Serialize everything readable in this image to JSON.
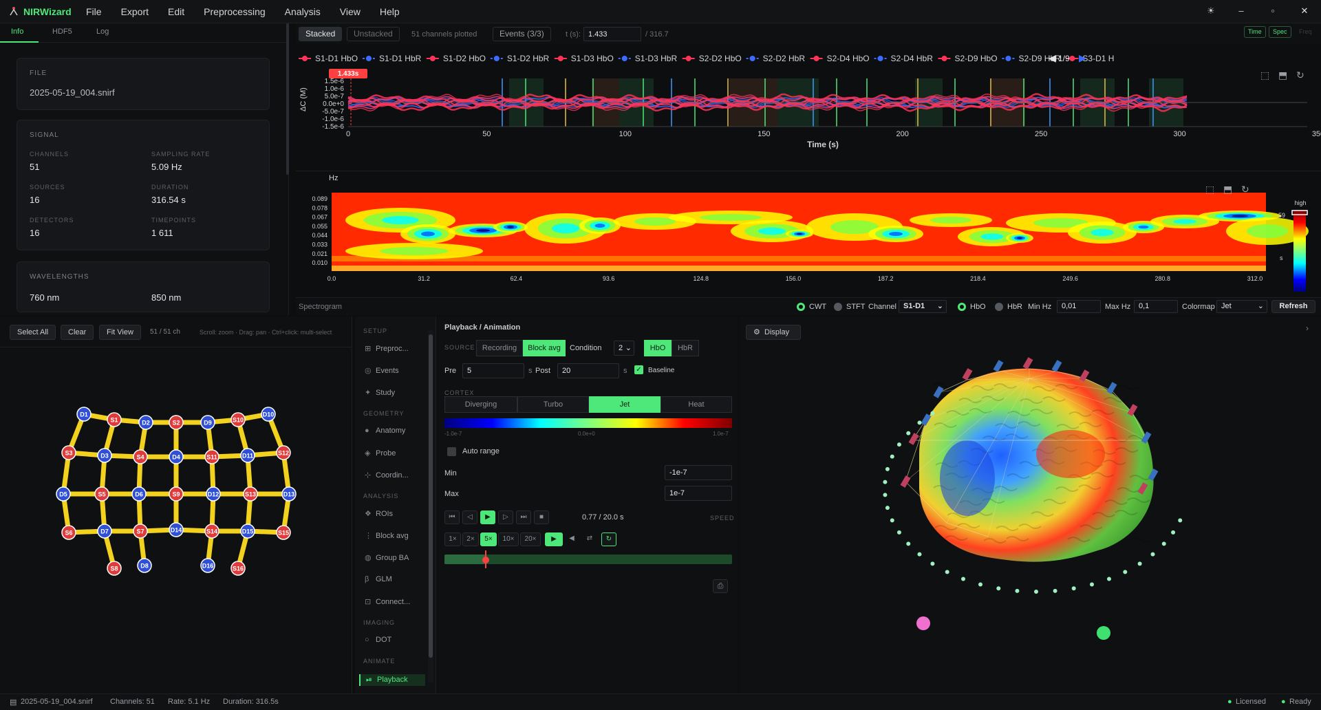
{
  "app": {
    "title": "NIRWizard",
    "menu": [
      "File",
      "Export",
      "Edit",
      "Preprocessing",
      "Analysis",
      "View",
      "Help"
    ]
  },
  "window": {
    "theme_icon": "☀",
    "min": "–",
    "max": "▫",
    "close": "✕"
  },
  "left_tabs": [
    "Info",
    "HDF5",
    "Log"
  ],
  "file": {
    "section": "FILE",
    "name": "2025-05-19_004.snirf"
  },
  "signal": {
    "section": "SIGNAL",
    "channels_label": "CHANNELS",
    "channels": "51",
    "sampling_label": "SAMPLING RATE",
    "sampling": "5.09 Hz",
    "sources_label": "SOURCES",
    "sources": "16",
    "duration_label": "DURATION",
    "duration": "316.54 s",
    "detectors_label": "DETECTORS",
    "detectors": "16",
    "timepoints_label": "TIMEPOINTS",
    "timepoints": "1 611"
  },
  "wavelengths": {
    "section": "WAVELENGTHS",
    "w1": "760 nm",
    "w2": "850 nm"
  },
  "toolbar": {
    "stacked": "Stacked",
    "unstacked": "Unstacked",
    "plotted": "51 channels plotted",
    "events": "Events (3/3)",
    "t_label": "t (s):",
    "t_value": "1.433",
    "t_total": "/ 316.7",
    "view_time": "Time",
    "view_spec": "Spec",
    "view_freq": "Freq"
  },
  "legend": {
    "items": [
      "S1-D1 HbO",
      "S1-D1 HbR",
      "S1-D2 HbO",
      "S1-D2 HbR",
      "S1-D3 HbO",
      "S1-D3 HbR",
      "S2-D2 HbO",
      "S2-D2 HbR",
      "S2-D4 HbO",
      "S2-D4 HbR",
      "S2-D9 HbO",
      "S2-D9 HbR",
      "S3-D1 H"
    ],
    "page": "1/9"
  },
  "timeseries": {
    "cursor_label": "1.433s",
    "ylabel": "ΔC (M)",
    "yticks": [
      "1.5e-6",
      "1.0e-6",
      "5.0e-7",
      "0.0e+0",
      "-5.0e-7",
      "-1.0e-6",
      "-1.5e-6"
    ],
    "xlabel": "Time (s)",
    "xticks": [
      "0",
      "50",
      "100",
      "150",
      "200",
      "250",
      "300",
      "350"
    ]
  },
  "spectrogram": {
    "hz": "Hz",
    "yticks": [
      "0.089",
      "0.078",
      "0.067",
      "0.055",
      "0.044",
      "0.033",
      "0.021",
      "0.010"
    ],
    "xticks": [
      "0.0",
      "31.2",
      "62.4",
      "93.6",
      "124.8",
      "156.0",
      "187.2",
      "218.4",
      "249.6",
      "280.8",
      "312.0"
    ],
    "cb_high": "high",
    "cb_val": "-59",
    "cb_unit": "s"
  },
  "spec_footer": {
    "title": "Spectrogram",
    "cwt": "CWT",
    "stft": "STFT",
    "channel_label": "Channel",
    "channel": "S1-D1",
    "hbo": "HbO",
    "hbr": "HbR",
    "minhz_label": "Min Hz",
    "minhz": "0,01",
    "maxhz_label": "Max Hz",
    "maxhz": "0,1",
    "cmap_label": "Colormap",
    "cmap": "Jet",
    "refresh": "Refresh"
  },
  "probe": {
    "select_all": "Select All",
    "clear": "Clear",
    "fit": "Fit View",
    "count": "51 / 51 ch",
    "hint": "Scroll: zoom · Drag: pan · Ctrl+click: multi-select"
  },
  "sidebar": {
    "setup": "SETUP",
    "preproc": "Preproc...",
    "events": "Events",
    "study": "Study",
    "geometry": "GEOMETRY",
    "anatomy": "Anatomy",
    "probe": "Probe",
    "coord": "Coordin...",
    "analysis": "ANALYSIS",
    "rois": "ROIs",
    "blockavg": "Block avg",
    "groupba": "Group BA",
    "glm": "GLM",
    "connect": "Connect...",
    "imaging": "IMAGING",
    "dot": "DOT",
    "animate": "ANIMATE",
    "playback": "Playback"
  },
  "playback": {
    "title": "Playback / Animation",
    "source": "SOURCE",
    "recording": "Recording",
    "blockavg": "Block avg",
    "condition_label": "Condition",
    "condition": "2",
    "hbo": "HbO",
    "hbr": "HbR",
    "pre_label": "Pre",
    "pre": "5",
    "s1": "s",
    "post_label": "Post",
    "post": "20",
    "s2": "s",
    "baseline": "Baseline",
    "cortex": "CORTEX",
    "cmaps": [
      "Diverging",
      "Turbo",
      "Jet",
      "Heat"
    ],
    "cmin": "-1.0e-7",
    "cmid": "0.0e+0",
    "cmax": "1.0e-7",
    "autorange": "Auto range",
    "min_label": "Min",
    "min": "-1e-7",
    "max_label": "Max",
    "max": "1e-7",
    "time": "0.77 / 20.0 s",
    "speed": "SPEED",
    "speeds": [
      "1×",
      "2×",
      "5×",
      "10×",
      "20×"
    ],
    "progress": 0.14
  },
  "display": {
    "label": "Display"
  },
  "status": {
    "file": "2025-05-19_004.snirf",
    "channels": "Channels: 51",
    "rate": "Rate: 5.1 Hz",
    "duration": "Duration: 316.5s",
    "licensed": "Licensed",
    "ready": "Ready"
  },
  "colors": {
    "accent": "#4ee87a",
    "hbo": "#ff3355",
    "hbr": "#3d6bff"
  }
}
